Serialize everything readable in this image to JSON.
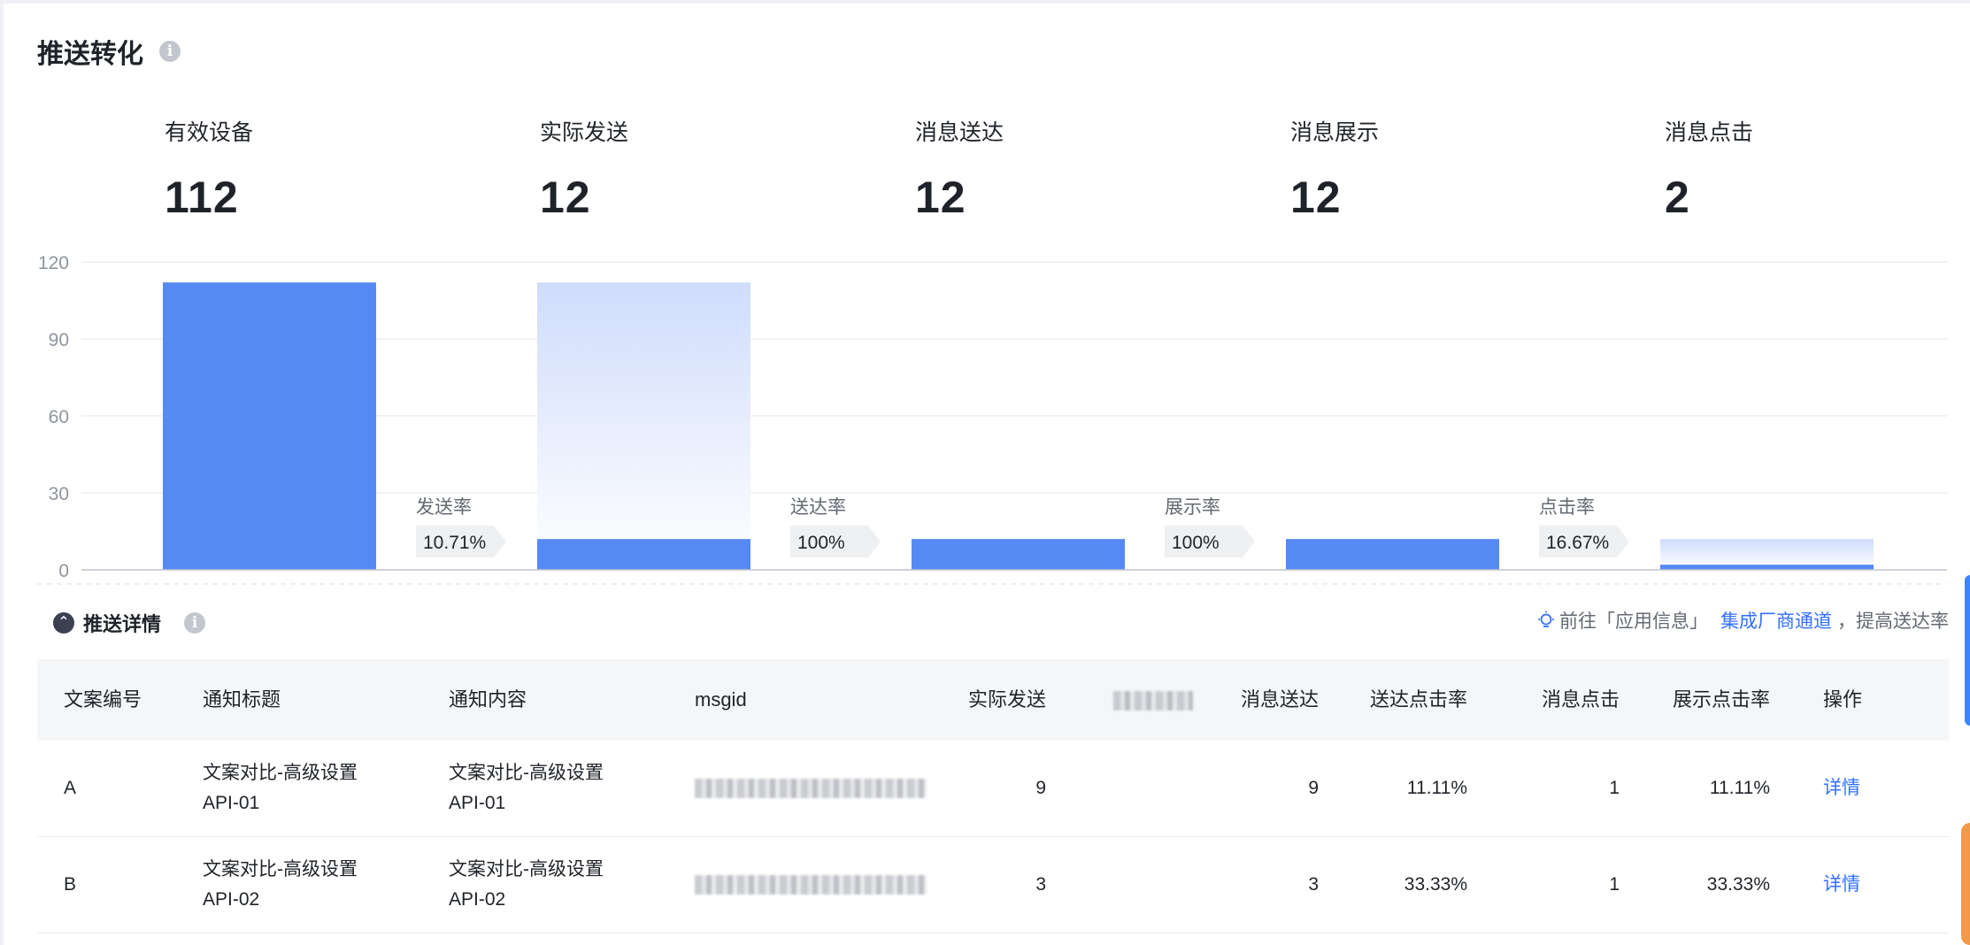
{
  "page": {
    "title": "推送转化"
  },
  "metrics": [
    {
      "label": "有效设备",
      "value": "112"
    },
    {
      "label": "实际发送",
      "value": "12"
    },
    {
      "label": "消息送达",
      "value": "12"
    },
    {
      "label": "消息展示",
      "value": "12"
    },
    {
      "label": "消息点击",
      "value": "2"
    }
  ],
  "chart_data": {
    "type": "bar",
    "categories": [
      "有效设备",
      "实际发送",
      "消息送达",
      "消息展示",
      "消息点击"
    ],
    "values": [
      112,
      12,
      12,
      12,
      2
    ],
    "ylim": [
      0,
      120
    ],
    "yticks": [
      "0",
      "30",
      "60",
      "90",
      "120"
    ],
    "grid": true,
    "conversion_rates": [
      {
        "label": "发送率",
        "value": "10.71%"
      },
      {
        "label": "送达率",
        "value": "100%"
      },
      {
        "label": "展示率",
        "value": "100%"
      },
      {
        "label": "点击率",
        "value": "16.67%"
      }
    ],
    "colors": {
      "bar": "#5589f4",
      "ghost": "#d4e1fc",
      "axis": "#c0c4cc",
      "grid": "#eceef1",
      "tick": "#8f959e",
      "tag_bg": "#eff0f2"
    }
  },
  "details": {
    "title": "推送详情",
    "tip_prefix": "前往「应用信息」",
    "tip_link": "集成厂商通道",
    "tip_suffix": "，提高送达率"
  },
  "table": {
    "headers": [
      "文案编号",
      "通知标题",
      "通知内容",
      "msgid",
      "实际发送",
      "",
      "消息送达",
      "送达点击率",
      "消息点击",
      "展示点击率",
      "操作"
    ],
    "rows": [
      {
        "id": "A",
        "title_line1": "文案对比-高级设置",
        "title_line2": "API-01",
        "content_line1": "文案对比-高级设置",
        "content_line2": "API-01",
        "sent": "9",
        "delivered": "9",
        "deliver_click_rate": "11.11%",
        "clicks": "1",
        "show_click_rate": "11.11%",
        "action": "详情"
      },
      {
        "id": "B",
        "title_line1": "文案对比-高级设置",
        "title_line2": "API-02",
        "content_line1": "文案对比-高级设置",
        "content_line2": "API-02",
        "sent": "3",
        "delivered": "3",
        "deliver_click_rate": "33.33%",
        "clicks": "1",
        "show_click_rate": "33.33%",
        "action": "详情"
      }
    ]
  }
}
